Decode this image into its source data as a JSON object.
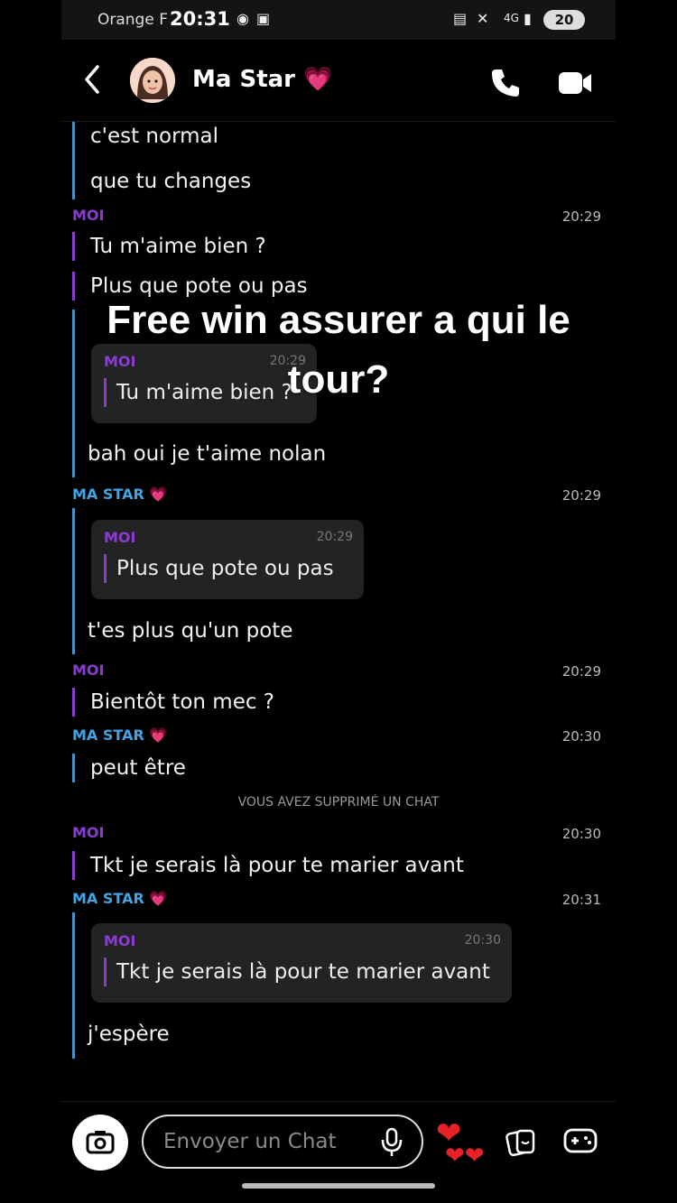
{
  "status_bar": {
    "carrier": "Orange F",
    "time": "20:31",
    "network": "4G",
    "battery": "20"
  },
  "header": {
    "contact_name": "Ma Star",
    "contact_emoji": "💗"
  },
  "messages": [
    {
      "text": "c'est normal"
    },
    {
      "text": "que tu changes"
    },
    {
      "sender": "MOI",
      "time": "20:29",
      "text": "Tu m'aime bien ?"
    },
    {
      "text": "Plus que pote ou pas"
    },
    {
      "quote": {
        "sender": "MOI",
        "time": "20:29",
        "text": "Tu m'aime bien ?"
      }
    },
    {
      "text": "bah oui je t'aime nolan"
    },
    {
      "sender": "MA STAR 💗",
      "time": "20:29"
    },
    {
      "quote": {
        "sender": "MOI",
        "time": "20:29",
        "text": "Plus que pote ou pas"
      }
    },
    {
      "text": "t'es plus qu'un pote"
    },
    {
      "sender": "MOI",
      "time": "20:29",
      "text": "Bientôt ton mec ?"
    },
    {
      "sender": "MA STAR 💗",
      "time": "20:30",
      "text": "peut être"
    },
    {
      "system": "VOUS AVEZ SUPPRIMÉ UN CHAT"
    },
    {
      "sender": "MOI",
      "time": "20:30",
      "text": "Tkt je serais là pour te marier avant"
    },
    {
      "sender": "MA STAR 💗",
      "time": "20:31"
    },
    {
      "quote": {
        "sender": "MOI",
        "time": "20:30",
        "text": "Tkt je serais là pour te marier avant"
      }
    },
    {
      "text": "j'espère"
    }
  ],
  "overlay_caption": "Free win assurer a qui le tour?",
  "composer": {
    "placeholder": "Envoyer un Chat"
  },
  "colors": {
    "me": "#8a3cd1",
    "star": "#3ea4e6",
    "background": "#000000"
  }
}
